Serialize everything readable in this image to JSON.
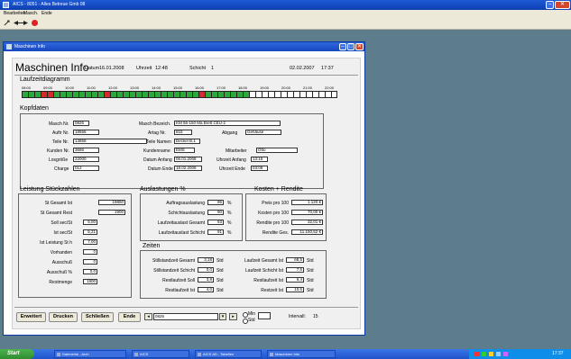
{
  "app": {
    "title": "AICS - 8051 - Alles Betreue Gmb 08",
    "menu": [
      "Bearbeiten",
      "Masch.",
      "Ende"
    ]
  },
  "window": {
    "title": "Maschinen Info"
  },
  "header": {
    "title": "Maschinen Info",
    "datum_label": "Datum",
    "datum": "16.01.2008",
    "uhrzeit_label": "Uhrzeit",
    "uhrzeit": "12:48",
    "schicht_label": "Schicht",
    "schicht": "1",
    "date_right": "02.02.2007",
    "time_right": "17:37"
  },
  "laufzeit": {
    "title": "Laufzeitdiagramm",
    "times": [
      "08:00",
      "09:00",
      "10:00",
      "11:00",
      "12:00",
      "13:00",
      "14:00",
      "15:00",
      "16:00",
      "17:00",
      "18:00",
      "19:00",
      "20:00",
      "21:00",
      "22:00"
    ],
    "segments": [
      "run",
      "run",
      "run",
      "stop",
      "stop",
      "run",
      "run",
      "run",
      "run",
      "run",
      "run",
      "run",
      "run",
      "stop",
      "run",
      "run",
      "run",
      "run",
      "run",
      "run",
      "run",
      "run",
      "run",
      "run",
      "run",
      "run",
      "run",
      "run",
      "stop",
      "run",
      "run",
      "run",
      "run",
      "run",
      "run",
      "run",
      "off",
      "off",
      "off",
      "off",
      "off",
      "off",
      "off",
      "off",
      "off",
      "off",
      "off",
      "off",
      "off",
      "off"
    ],
    "colors": {
      "run": "#2da83a",
      "stop": "#d42a2a",
      "off": "#ffffff"
    }
  },
  "kopfdaten": {
    "title": "Kopfdaten",
    "fields": [
      {
        "label": "Masch Nr.",
        "value": "0826"
      },
      {
        "label": "Auftr Nr.",
        "value": "18556"
      },
      {
        "label": "Teile Nr.",
        "value": "13858"
      },
      {
        "label": "Kunden Nr.",
        "value": "3666"
      },
      {
        "label": "Losgröße",
        "value": "22000"
      },
      {
        "label": "Charge",
        "value": "012"
      },
      {
        "label": "Masch Bezeich.",
        "value": "KM 56-150 Ma Brett CEU-2"
      },
      {
        "label": "Artag Nr.",
        "value": "815"
      },
      {
        "label": "Teile Namen",
        "value": "Deckel B.1"
      },
      {
        "label": "Kundenname",
        "value": "EMS"
      },
      {
        "label": "Datum Anfang",
        "value": "06.01.2008"
      },
      {
        "label": "Datum Ende",
        "value": "18.02.2008"
      },
      {
        "label": "Abgang",
        "value": "Gehäuse"
      },
      {
        "label": "Mitarbeiter",
        "value": "Otto"
      },
      {
        "label": "Uhrzeit Anfang",
        "value": "13:16"
      },
      {
        "label": "Uhrzeit Ende",
        "value": "03:08"
      }
    ]
  },
  "leistung": {
    "title": "Leistung Stückzahlen",
    "fields": [
      {
        "label": "St Gesamt Ist",
        "value": "19850"
      },
      {
        "label": "St Gesamt Rest",
        "value": "1900"
      },
      {
        "label": "Soll sec/St",
        "value": "5,00"
      },
      {
        "label": "Ist sec/St",
        "value": "5,21"
      },
      {
        "label": "Ist Leistung St h",
        "value": "7,00"
      },
      {
        "label": "Vorhanden",
        "value": "0"
      },
      {
        "label": "Ausschuß",
        "value": "0"
      },
      {
        "label": "Ausschuß %",
        "value": "0,0"
      },
      {
        "label": "Restmenge",
        "value": "1900"
      }
    ]
  },
  "auslastungen": {
    "title": "Auslastungen %",
    "unit": "%",
    "fields": [
      {
        "label": "Auftragsauslastung",
        "value": "96"
      },
      {
        "label": "Schichtauslastung",
        "value": "90"
      },
      {
        "label": "Laufzeitauslast Gesamt",
        "value": "93"
      },
      {
        "label": "Laufzeitauslast Schicht",
        "value": "91"
      }
    ]
  },
  "kosten": {
    "title": "Kosten + Rendite",
    "fields": [
      {
        "label": "Preis pro 100",
        "value": "1.120 €"
      },
      {
        "label": "Kosten pro 100",
        "value": "70,00 €"
      },
      {
        "label": "Rendite pro 100",
        "value": "32,01 €"
      },
      {
        "label": "Rendite Ges.",
        "value": "11.150,52 €"
      }
    ]
  },
  "zeiten": {
    "title": "Zeiten",
    "unit": "Std",
    "left": [
      {
        "label": "Stillstandzeit Gesamt",
        "value": "3,18"
      },
      {
        "label": "Stillstandzeit Schicht",
        "value": "0,0"
      },
      {
        "label": "Restlaufzeit Soll",
        "value": "3,8"
      },
      {
        "label": "Restlaufzeit Ist",
        "value": "4,0"
      }
    ],
    "right": [
      {
        "label": "Laufzeit Gesamt Ist",
        "value": "68,5"
      },
      {
        "label": "Laufzeit Schicht Ist",
        "value": "7,5"
      },
      {
        "label": "Restlaufzeit Ist",
        "value": "6,4"
      },
      {
        "label": "Restzeit Ist",
        "value": "10,5"
      }
    ]
  },
  "footer": {
    "buttons": [
      "Erweitert",
      "Drucken",
      "Schließen",
      "Ende"
    ],
    "masch_select": "0826",
    "opt1": "Min",
    "opt2": "Std",
    "interval_label": "Intervall:",
    "interval_value": "15"
  },
  "taskbar": {
    "start": "Start",
    "tasks": [
      "Dateneink - Arch",
      "AICS",
      "AICS AD - Tabellen",
      "Maschinen Info"
    ],
    "clock": "17:37"
  }
}
